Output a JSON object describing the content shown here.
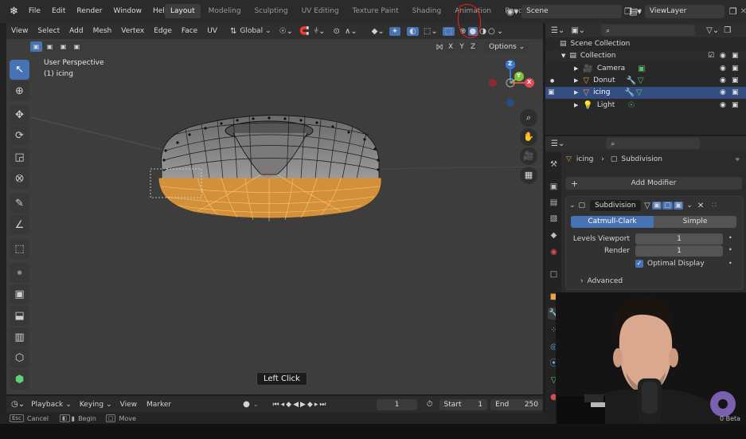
{
  "topbar": {
    "menus": [
      "File",
      "Edit",
      "Render",
      "Window",
      "Help"
    ],
    "workspaces": [
      "Layout",
      "Modeling",
      "Sculpting",
      "UV Editing",
      "Texture Paint",
      "Shading",
      "Animation",
      "Rendering"
    ],
    "active_workspace": "Layout",
    "scene": "Scene",
    "view_layer": "ViewLayer"
  },
  "viewport": {
    "menus": [
      "View",
      "Select",
      "Add",
      "Mesh",
      "Vertex",
      "Edge",
      "Face",
      "UV"
    ],
    "transform_orientation": "Global",
    "options_label": "Options",
    "axis_labels": [
      "X",
      "Y",
      "Z"
    ],
    "perspective_label": "User Perspective",
    "object_label": "(1) icing",
    "gizmo_axes": {
      "z": "Z",
      "y": "Y",
      "x": "X"
    },
    "tooltip": "Left Click"
  },
  "timeline": {
    "menus": [
      "Playback",
      "Keying",
      "View",
      "Marker"
    ],
    "current_frame": "1",
    "start_label": "Start",
    "start_value": "1",
    "end_label": "End",
    "end_value": "250"
  },
  "statusbar": {
    "items": [
      {
        "key": "Esc",
        "label": "Cancel"
      },
      {
        "key": "",
        "label": "Begin"
      },
      {
        "key": "",
        "label": "Move"
      }
    ],
    "version": "0 Beta"
  },
  "outliner": {
    "root": "Scene Collection",
    "collection": "Collection",
    "items": [
      {
        "name": "Camera",
        "selected": false
      },
      {
        "name": "Donut",
        "selected": false
      },
      {
        "name": "icing",
        "selected": true
      },
      {
        "name": "Light",
        "selected": false
      }
    ]
  },
  "properties": {
    "breadcrumb_object": "icing",
    "breadcrumb_modifier": "Subdivision",
    "add_modifier": "Add Modifier",
    "modifier_name": "Subdivision",
    "mode_catmull": "Catmull-Clark",
    "mode_simple": "Simple",
    "levels_viewport_label": "Levels Viewport",
    "levels_viewport_value": "1",
    "render_label": "Render",
    "render_value": "1",
    "optimal_display": "Optimal Display",
    "advanced": "Advanced"
  },
  "colors": {
    "accent": "#4772b3",
    "selection_orange": "#f5a230",
    "outliner_selected": "#334d80",
    "annotation_red": "#d81f1f"
  }
}
